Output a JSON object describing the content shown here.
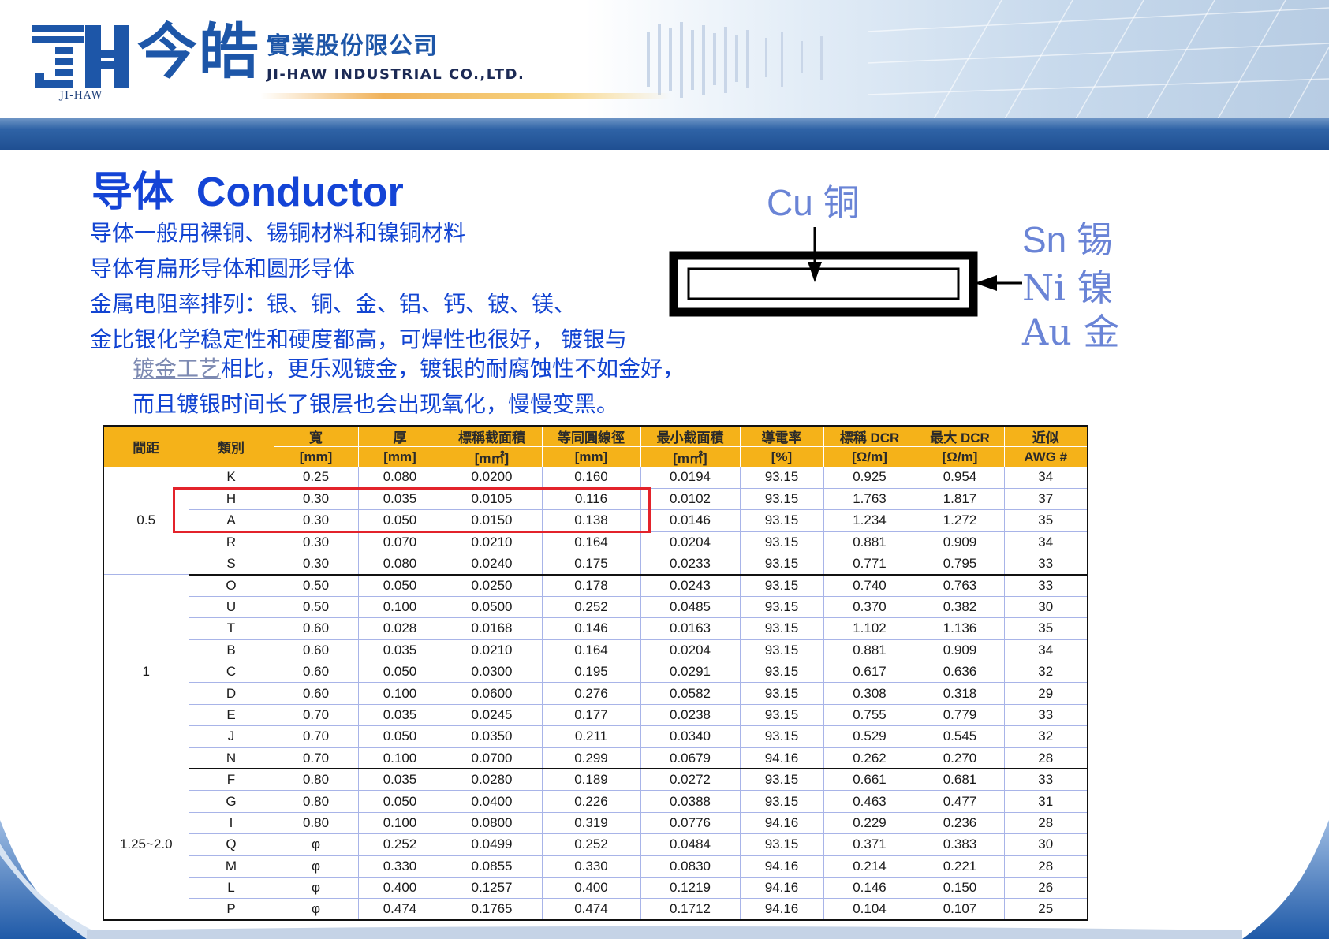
{
  "header": {
    "logo_cn": "今皓",
    "logo_corp_cn": "實業股份限公司",
    "logo_en": "JI-HAW INDUSTRIAL CO.,LTD.",
    "logo_sub": "JI-HAW"
  },
  "title": {
    "cn": "导体",
    "en": "Conductor"
  },
  "paragraphs": {
    "line1": "导体一般用裸铜、锡铜材料和镍铜材料",
    "line2": "导体有扁形导体和圆形导体",
    "line3": "金属电阻率排列：银、铜、金、铝、钙、铍、镁、",
    "line4": "金比银化学稳定性和硬度都高，可焊性也很好， 镀银与",
    "line5_link": "镀金工艺",
    "line5_rest": "相比，更乐观镀金，镀银的耐腐蚀性不如金好，",
    "line6": "而且镀银时间长了银层也会出现氧化，慢慢变黑。"
  },
  "diagram": {
    "cu": "Cu  铜",
    "sn": "Sn  锡",
    "ni": "Ni  镍",
    "au": "Au  金"
  },
  "table": {
    "headers": {
      "pitch": "間距",
      "type": "類別",
      "width": "寬",
      "thickness": "厚",
      "nominal_area": "標稱截面積",
      "equiv_dia": "等同圓線徑",
      "min_area": "最小截面積",
      "conductivity": "導電率",
      "nominal_dcr": "標稱 DCR",
      "max_dcr": "最大 DCR",
      "awg": "近似"
    },
    "units": {
      "width": "[mm]",
      "thickness": "[mm]",
      "nominal_area": "[m㎡]",
      "equiv_dia": "[mm]",
      "min_area": "[m㎡]",
      "conductivity": "[%]",
      "nominal_dcr": "[Ω/m]",
      "max_dcr": "[Ω/m]",
      "awg": "AWG #"
    },
    "groups": {
      "g1": "0.5",
      "g2": "1",
      "g3": "1.25~2.0"
    },
    "rows": [
      [
        "K",
        "0.25",
        "0.080",
        "0.0200",
        "0.160",
        "0.0194",
        "93.15",
        "0.925",
        "0.954",
        "34"
      ],
      [
        "H",
        "0.30",
        "0.035",
        "0.0105",
        "0.116",
        "0.0102",
        "93.15",
        "1.763",
        "1.817",
        "37"
      ],
      [
        "A",
        "0.30",
        "0.050",
        "0.0150",
        "0.138",
        "0.0146",
        "93.15",
        "1.234",
        "1.272",
        "35"
      ],
      [
        "R",
        "0.30",
        "0.070",
        "0.0210",
        "0.164",
        "0.0204",
        "93.15",
        "0.881",
        "0.909",
        "34"
      ],
      [
        "S",
        "0.30",
        "0.080",
        "0.0240",
        "0.175",
        "0.0233",
        "93.15",
        "0.771",
        "0.795",
        "33"
      ],
      [
        "O",
        "0.50",
        "0.050",
        "0.0250",
        "0.178",
        "0.0243",
        "93.15",
        "0.740",
        "0.763",
        "33"
      ],
      [
        "U",
        "0.50",
        "0.100",
        "0.0500",
        "0.252",
        "0.0485",
        "93.15",
        "0.370",
        "0.382",
        "30"
      ],
      [
        "T",
        "0.60",
        "0.028",
        "0.0168",
        "0.146",
        "0.0163",
        "93.15",
        "1.102",
        "1.136",
        "35"
      ],
      [
        "B",
        "0.60",
        "0.035",
        "0.0210",
        "0.164",
        "0.0204",
        "93.15",
        "0.881",
        "0.909",
        "34"
      ],
      [
        "C",
        "0.60",
        "0.050",
        "0.0300",
        "0.195",
        "0.0291",
        "93.15",
        "0.617",
        "0.636",
        "32"
      ],
      [
        "D",
        "0.60",
        "0.100",
        "0.0600",
        "0.276",
        "0.0582",
        "93.15",
        "0.308",
        "0.318",
        "29"
      ],
      [
        "E",
        "0.70",
        "0.035",
        "0.0245",
        "0.177",
        "0.0238",
        "93.15",
        "0.755",
        "0.779",
        "33"
      ],
      [
        "J",
        "0.70",
        "0.050",
        "0.0350",
        "0.211",
        "0.0340",
        "93.15",
        "0.529",
        "0.545",
        "32"
      ],
      [
        "N",
        "0.70",
        "0.100",
        "0.0700",
        "0.299",
        "0.0679",
        "94.16",
        "0.262",
        "0.270",
        "28"
      ],
      [
        "F",
        "0.80",
        "0.035",
        "0.0280",
        "0.189",
        "0.0272",
        "93.15",
        "0.661",
        "0.681",
        "33"
      ],
      [
        "G",
        "0.80",
        "0.050",
        "0.0400",
        "0.226",
        "0.0388",
        "93.15",
        "0.463",
        "0.477",
        "31"
      ],
      [
        "I",
        "0.80",
        "0.100",
        "0.0800",
        "0.319",
        "0.0776",
        "94.16",
        "0.229",
        "0.236",
        "28"
      ],
      [
        "Q",
        "φ",
        "0.252",
        "0.0499",
        "0.252",
        "0.0484",
        "93.15",
        "0.371",
        "0.383",
        "30"
      ],
      [
        "M",
        "φ",
        "0.330",
        "0.0855",
        "0.330",
        "0.0830",
        "94.16",
        "0.214",
        "0.221",
        "28"
      ],
      [
        "L",
        "φ",
        "0.400",
        "0.1257",
        "0.400",
        "0.1219",
        "94.16",
        "0.146",
        "0.150",
        "26"
      ],
      [
        "P",
        "φ",
        "0.474",
        "0.1765",
        "0.474",
        "0.1712",
        "94.16",
        "0.104",
        "0.107",
        "25"
      ]
    ]
  },
  "colors": {
    "title": "#1444d6",
    "text": "#1244d2",
    "diagram_label": "#6a84d6",
    "table_header": "#f5b219",
    "highlight": "#e3232b",
    "brand_blue": "#1d56a8"
  }
}
